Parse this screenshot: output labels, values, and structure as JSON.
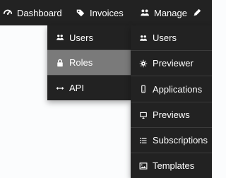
{
  "nav": {
    "dashboard": {
      "label": "Dashboard",
      "icon": "dashboard-icon"
    },
    "invoices": {
      "label": "Invoices",
      "icon": "tag-icon"
    },
    "manage": {
      "label": "Manage",
      "icon": "users-icon"
    },
    "edit": {
      "icon": "pencil-icon"
    }
  },
  "left_menu": {
    "items": [
      {
        "label": "Users",
        "icon": "users-icon"
      },
      {
        "label": "Roles",
        "icon": "lock-icon",
        "active": true
      },
      {
        "label": "API",
        "icon": "left-right-arrow-icon"
      }
    ]
  },
  "right_menu": {
    "items": [
      {
        "label": "Users",
        "icon": "users-icon"
      },
      {
        "label": "Previewer",
        "icon": "gear-icon"
      },
      {
        "label": "Applications",
        "icon": "mobile-icon"
      },
      {
        "label": "Previews",
        "icon": "monitor-icon"
      },
      {
        "label": "Subscriptions",
        "icon": "list-icon"
      },
      {
        "label": "Templates",
        "icon": "image-icon"
      }
    ]
  },
  "colors": {
    "bar": "#222222",
    "menu": "#222222",
    "active": "#7a7a7a",
    "text": "#ffffff",
    "page": "#fbfcfd"
  }
}
